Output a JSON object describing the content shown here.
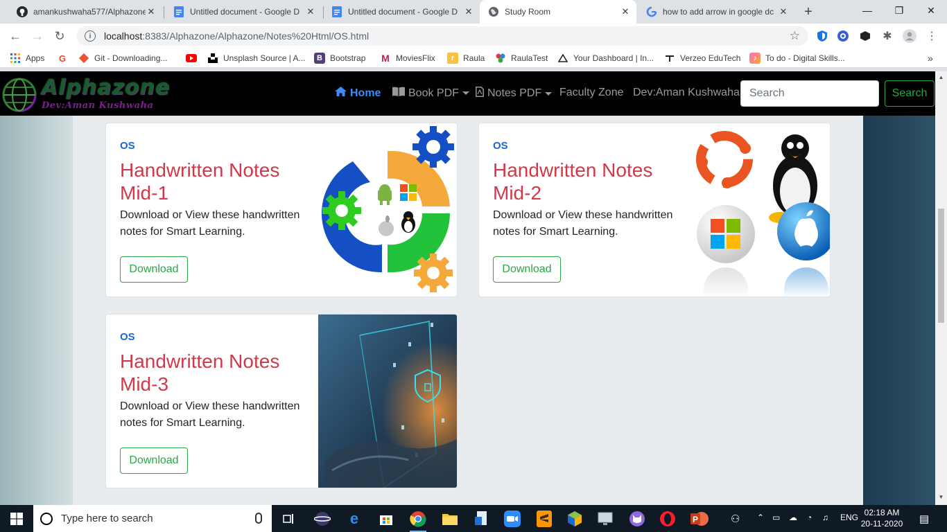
{
  "browser": {
    "tabs": [
      {
        "title": "amankushwaha577/Alphazone",
        "icon": "github-icon"
      },
      {
        "title": "Untitled document - Google D",
        "icon": "google-docs-icon"
      },
      {
        "title": "Untitled document - Google D",
        "icon": "google-docs-icon"
      },
      {
        "title": "Study Room",
        "icon": "globe-icon"
      },
      {
        "title": "how to add arrow in google dc",
        "icon": "google-icon"
      }
    ],
    "url_host": "localhost",
    "url_rest": ":8383/Alphazone/Alphazone/Notes%20Html/OS.html",
    "bookmarks": [
      {
        "label": "Apps",
        "icon": "apps-grid-icon"
      },
      {
        "label": "",
        "icon": "google-icon"
      },
      {
        "label": "Git - Downloading...",
        "icon": "git-icon"
      },
      {
        "label": "",
        "icon": "youtube-icon"
      },
      {
        "label": "Unsplash Source | A...",
        "icon": "unsplash-icon"
      },
      {
        "label": "Bootstrap",
        "icon": "bootstrap-icon"
      },
      {
        "label": "MoviesFlix",
        "icon": "moviesflix-icon"
      },
      {
        "label": "Raula",
        "icon": "raula-icon"
      },
      {
        "label": "RaulaTest",
        "icon": "raulatest-icon"
      },
      {
        "label": "Your Dashboard | In...",
        "icon": "dashboard-icon"
      },
      {
        "label": "Verzeo EduTech",
        "icon": "verzeo-icon"
      },
      {
        "label": "To do - Digital Skills...",
        "icon": "todo-icon"
      }
    ],
    "more_bookmarks": "»"
  },
  "site": {
    "brand": "Alphazone",
    "brand_sub": "Dev:Aman Kushwaha",
    "nav": {
      "home": "Home",
      "book_pdf": "Book PDF",
      "notes_pdf": "Notes PDF",
      "faculty": "Faculty Zone",
      "dev": "Dev:Aman Kushwaha"
    },
    "search_placeholder": "Search",
    "search_button": "Search"
  },
  "cards": [
    {
      "tag": "OS",
      "heading": "Handwritten Notes Mid-1",
      "desc": "Download or View these handwritten notes for Smart Learning.",
      "button": "Download"
    },
    {
      "tag": "OS",
      "heading": "Handwritten Notes Mid-2",
      "desc": "Download or View these handwritten notes for Smart Learning.",
      "button": "Download"
    },
    {
      "tag": "OS",
      "heading": "Handwritten Notes Mid-3",
      "desc": "Download or View these handwritten notes for Smart Learning.",
      "button": "Download"
    }
  ],
  "taskbar": {
    "search_placeholder": "Type here to search",
    "lang": "ENG",
    "time": "02:18 AM",
    "date": "20-11-2020"
  },
  "colors": {
    "accent_green": "#28a745",
    "heading_red": "#d2384a",
    "tag_blue": "#1766d6",
    "nav_active": "#3b8cff"
  }
}
